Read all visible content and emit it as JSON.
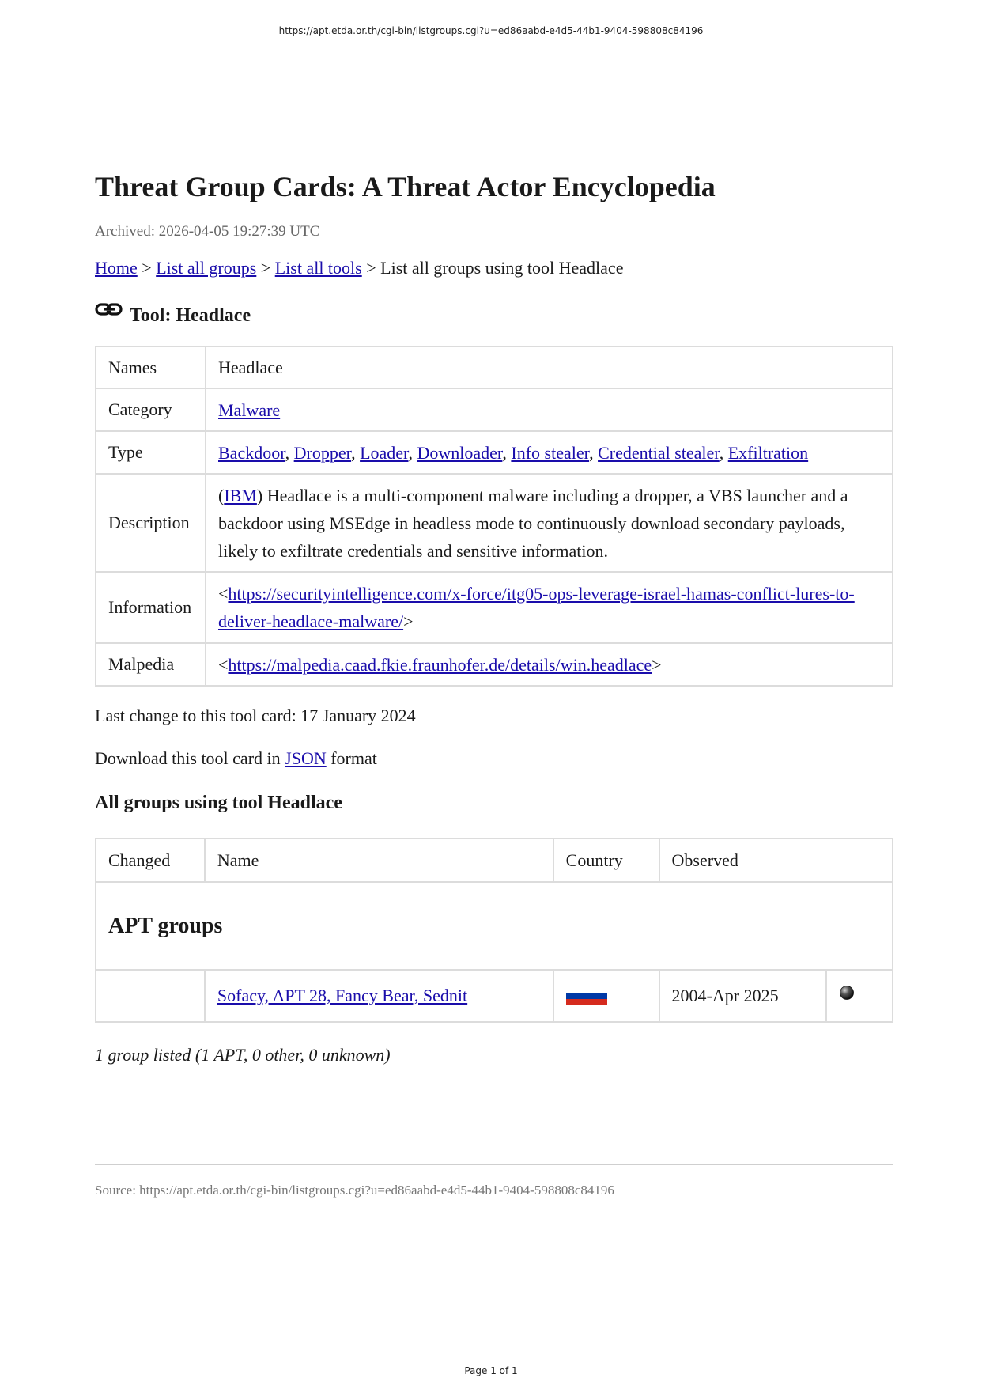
{
  "print": {
    "header_url": "https://apt.etda.or.th/cgi-bin/listgroups.cgi?u=ed86aabd-e4d5-44b1-9404-598808c84196",
    "footer": "Page 1 of 1"
  },
  "page": {
    "title": "Threat Group Cards: A Threat Actor Encyclopedia",
    "archived": "Archived: 2026-04-05 19:27:39 UTC"
  },
  "breadcrumb": {
    "home": "Home",
    "sep": ">",
    "all_groups": "List all groups",
    "all_tools": "List all tools",
    "current": "List all groups using tool Headlace"
  },
  "tool": {
    "heading": "Tool: Headlace",
    "names_label": "Names",
    "names_value": "Headlace",
    "category_label": "Category",
    "category_value": "Malware",
    "type_label": "Type",
    "types": [
      "Backdoor",
      "Dropper",
      "Loader",
      "Downloader",
      "Info stealer",
      "Credential stealer",
      "Exfiltration"
    ],
    "description_label": "Description",
    "description_source": "IBM",
    "description_text": ") Headlace is a multi-component malware including a dropper, a VBS launcher and a backdoor using MSEdge in headless mode to continuously download secondary payloads, likely to exfiltrate credentials and sensitive information.",
    "information_label": "Information",
    "information_url": "https://securityintelligence.com/x-force/itg05-ops-leverage-israel-hamas-conflict-lures-to-deliver-headlace-malware/",
    "malpedia_label": "Malpedia",
    "malpedia_url": "https://malpedia.caad.fkie.fraunhofer.de/details/win.headlace"
  },
  "last_change": "Last change to this tool card: 17 January 2024",
  "download": {
    "prefix": "Download this tool card in ",
    "link": "JSON",
    "suffix": " format"
  },
  "groups": {
    "heading": "All groups using tool Headlace",
    "headers": {
      "changed": "Changed",
      "name": "Name",
      "country": "Country",
      "observed": "Observed"
    },
    "section": "APT groups",
    "rows": [
      {
        "changed": "",
        "name": "Sofacy, APT 28, Fancy Bear, Sednit",
        "flag_colors": [
          "#ffffff",
          "#0039a6",
          "#d52b1e"
        ],
        "observed": "2004-Apr 2025"
      }
    ],
    "summary": "1 group listed (1 APT, 0 other, 0 unknown)"
  },
  "source": "Source: https://apt.etda.or.th/cgi-bin/listgroups.cgi?u=ed86aabd-e4d5-44b1-9404-598808c84196"
}
